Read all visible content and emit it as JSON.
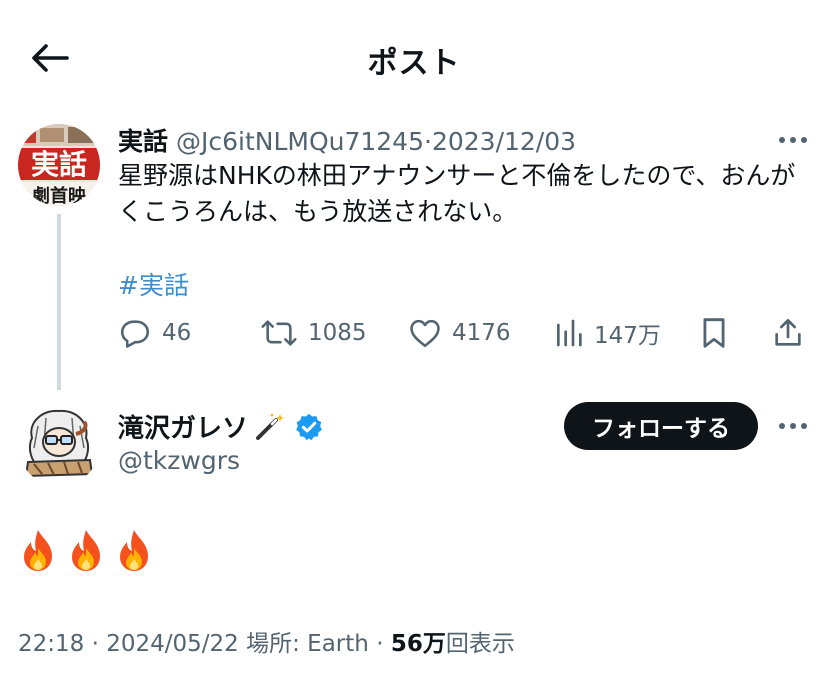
{
  "header": {
    "title": "ポスト",
    "back_icon": "arrow-left-icon"
  },
  "parent_tweet": {
    "author_name": "実話",
    "handle": "@Jc6itNLMQu71245",
    "separator": "·",
    "date": "2023/12/03",
    "avatar_text": [
      "実話",
      "劇首映"
    ],
    "text": "星野源はNHKの林田アナウンサーと不倫をしたので、おんがくこうろんは、もう放送されない。",
    "hashtag": "#実話",
    "replies": "46",
    "retweets": "1085",
    "likes": "4176",
    "views": "147万"
  },
  "main_tweet": {
    "author_name": "滝沢ガレソ",
    "handle": "@tkzwgrs",
    "follow_label": "フォローする",
    "emoji_text": [
      "🔥",
      "🔥",
      "🔥"
    ],
    "verified_color": "#1d9bf0"
  },
  "meta": {
    "time": "22:18",
    "dot1": "·",
    "date": "2024/05/22",
    "location": "場所: Earth",
    "dot2": "·",
    "views_num": "56万",
    "views_label": "回表示"
  },
  "colors": {
    "text": "#0f1419",
    "secondary": "#536471",
    "hashtag": "#3b8ed1",
    "thread_line": "#cfd9de",
    "follow_bg": "#0f1419"
  }
}
